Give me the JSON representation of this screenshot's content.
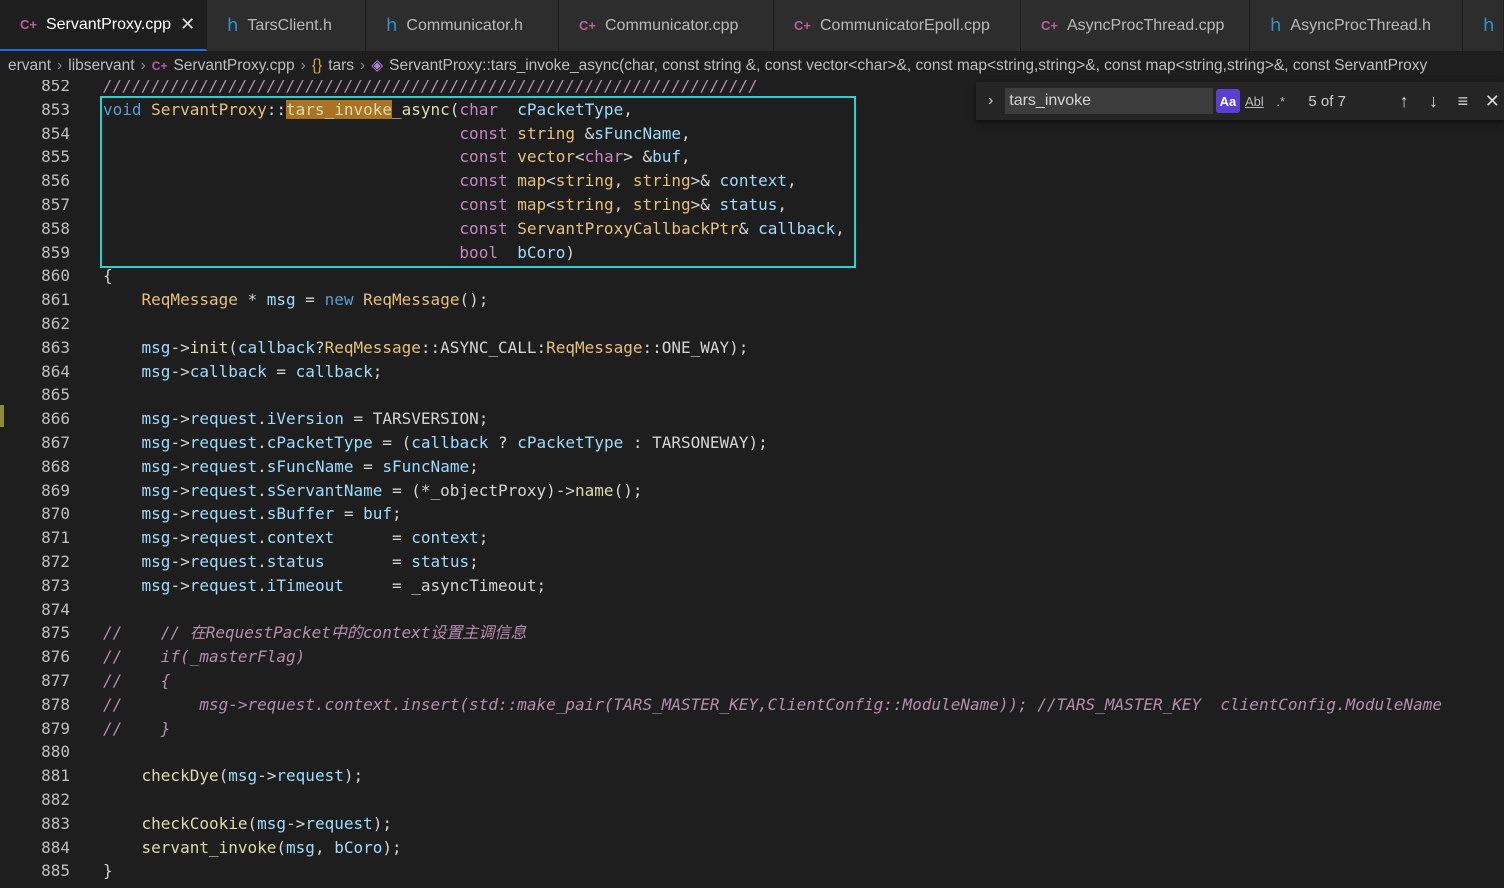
{
  "tabs": [
    {
      "icon": "C++",
      "label": "ServantProxy.cpp",
      "active": true
    },
    {
      "icon": "h",
      "label": "TarsClient.h"
    },
    {
      "icon": "h",
      "label": "Communicator.h"
    },
    {
      "icon": "C++",
      "label": "Communicator.cpp"
    },
    {
      "icon": "C++",
      "label": "CommunicatorEpoll.cpp"
    },
    {
      "icon": "C++",
      "label": "AsyncProcThread.cpp"
    },
    {
      "icon": "h",
      "label": "AsyncProcThread.h"
    },
    {
      "icon": "h",
      "label": ""
    }
  ],
  "breadcrumb": {
    "part1": "ervant",
    "part2": "libservant",
    "file": "ServantProxy.cpp",
    "ns": "tars",
    "symbol": "ServantProxy::tars_invoke_async(char, const string &, const vector<char>&, const map<string,string>&, const map<string,string>&, const ServantProxy"
  },
  "find": {
    "query": "tars_invoke",
    "match_case": "Aa",
    "whole_word": "Abl",
    "regex": ".*",
    "count": "5 of 7"
  },
  "lines": [
    {
      "n": "852",
      "t": "////////////////////////////////////////////////////////////////////"
    },
    {
      "n": "853",
      "t": "void ServantProxy::tars_invoke_async(char  cPacketType,"
    },
    {
      "n": "854",
      "t": "                                     const string &sFuncName,"
    },
    {
      "n": "855",
      "t": "                                     const vector<char> &buf,"
    },
    {
      "n": "856",
      "t": "                                     const map<string, string>& context,"
    },
    {
      "n": "857",
      "t": "                                     const map<string, string>& status,"
    },
    {
      "n": "858",
      "t": "                                     const ServantProxyCallbackPtr& callback,"
    },
    {
      "n": "859",
      "t": "                                     bool  bCoro)"
    },
    {
      "n": "860",
      "t": "{"
    },
    {
      "n": "861",
      "t": "    ReqMessage * msg = new ReqMessage();"
    },
    {
      "n": "862",
      "t": ""
    },
    {
      "n": "863",
      "t": "    msg->init(callback?ReqMessage::ASYNC_CALL:ReqMessage::ONE_WAY);"
    },
    {
      "n": "864",
      "t": "    msg->callback = callback;"
    },
    {
      "n": "865",
      "t": ""
    },
    {
      "n": "866",
      "t": "    msg->request.iVersion = TARSVERSION;"
    },
    {
      "n": "867",
      "t": "    msg->request.cPacketType = (callback ? cPacketType : TARSONEWAY);"
    },
    {
      "n": "868",
      "t": "    msg->request.sFuncName = sFuncName;"
    },
    {
      "n": "869",
      "t": "    msg->request.sServantName = (*_objectProxy)->name();"
    },
    {
      "n": "870",
      "t": "    msg->request.sBuffer = buf;"
    },
    {
      "n": "871",
      "t": "    msg->request.context      = context;"
    },
    {
      "n": "872",
      "t": "    msg->request.status       = status;"
    },
    {
      "n": "873",
      "t": "    msg->request.iTimeout     = _asyncTimeout;"
    },
    {
      "n": "874",
      "t": ""
    },
    {
      "n": "875",
      "t": "//    // 在RequestPacket中的context设置主调信息"
    },
    {
      "n": "876",
      "t": "//    if(_masterFlag)"
    },
    {
      "n": "877",
      "t": "//    {"
    },
    {
      "n": "878",
      "t": "//        msg->request.context.insert(std::make_pair(TARS_MASTER_KEY,ClientConfig::ModuleName)); //TARS_MASTER_KEY  clientConfig.ModuleName"
    },
    {
      "n": "879",
      "t": "//    }"
    },
    {
      "n": "880",
      "t": ""
    },
    {
      "n": "881",
      "t": "    checkDye(msg->request);"
    },
    {
      "n": "882",
      "t": ""
    },
    {
      "n": "883",
      "t": "    checkCookie(msg->request);"
    },
    {
      "n": "884",
      "t": "    servant_invoke(msg, bCoro);"
    },
    {
      "n": "885",
      "t": "}"
    }
  ]
}
